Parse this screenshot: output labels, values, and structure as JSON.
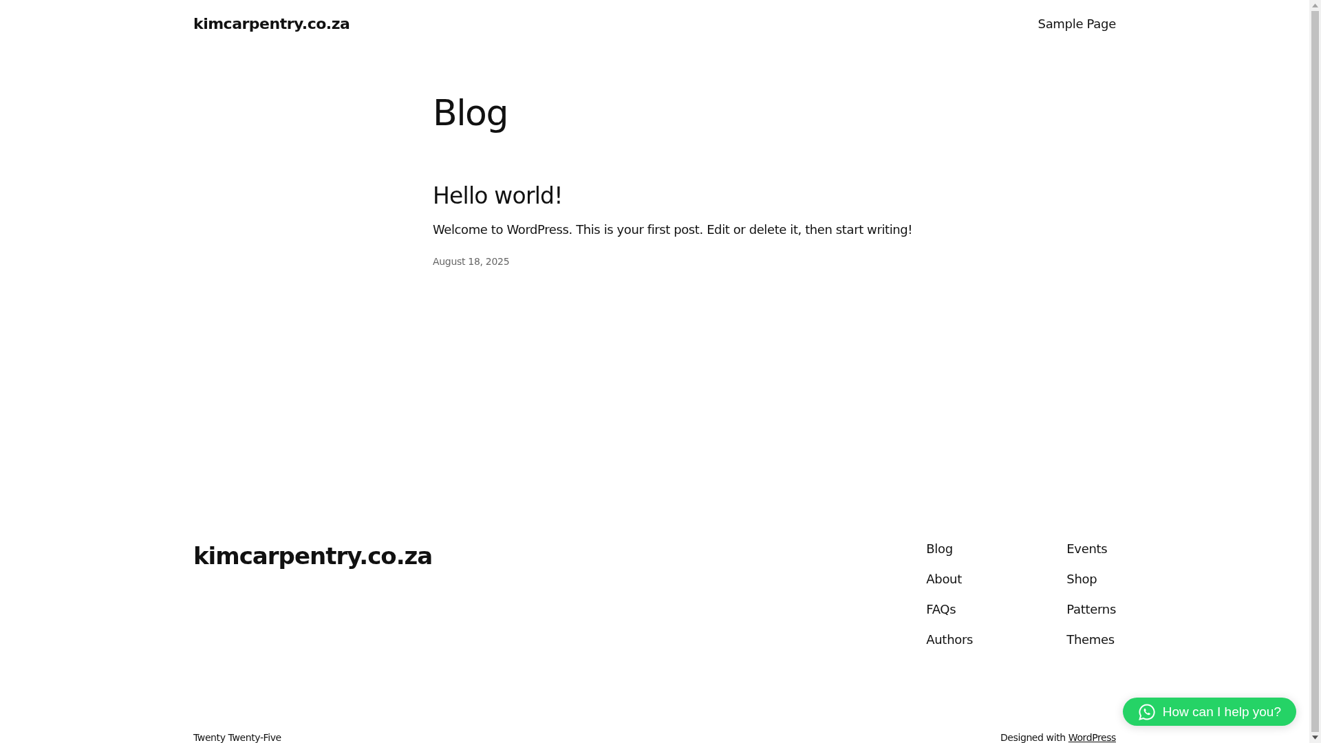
{
  "header": {
    "site_title": "kimcarpentry.co.za",
    "nav": [
      "Sample Page"
    ]
  },
  "main": {
    "title": "Blog",
    "posts": [
      {
        "title": "Hello world!",
        "excerpt": "Welcome to WordPress. This is your first post. Edit or delete it, then start writing!",
        "date": "August 18, 2025"
      }
    ]
  },
  "footer": {
    "site_title": "kimcarpentry.co.za",
    "nav_columns": [
      [
        "Blog",
        "About",
        "FAQs",
        "Authors"
      ],
      [
        "Events",
        "Shop",
        "Patterns",
        "Themes"
      ]
    ],
    "theme_credit": "Twenty Twenty-Five",
    "credit_prefix": "Designed with",
    "credit_link": "WordPress"
  },
  "chat_button": {
    "label": "How can I help you?"
  }
}
